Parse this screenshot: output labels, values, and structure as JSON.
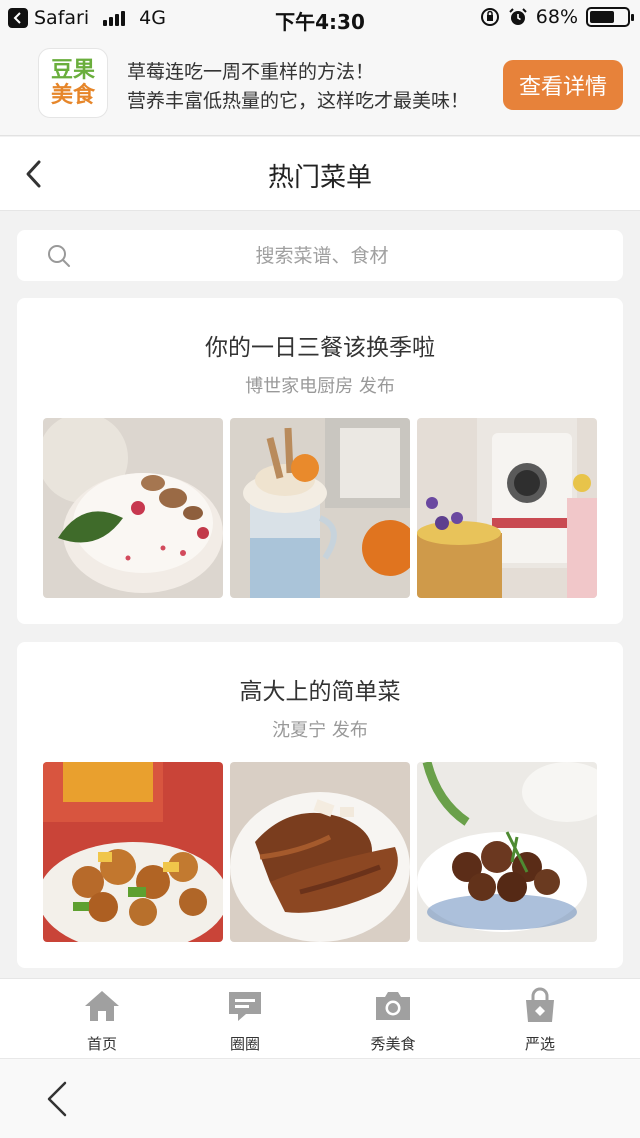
{
  "status_bar": {
    "app": "Safari",
    "network": "4G",
    "time": "下午4:30",
    "battery": "68%",
    "battery_level": 0.68
  },
  "banner": {
    "logo_line1": "豆果",
    "logo_line2": "美食",
    "line1": "草莓连吃一周不重样的方法！",
    "line2": "营养丰富低热量的它，这样吃才最美味！",
    "button": "查看详情"
  },
  "nav": {
    "title": "热门菜单",
    "back_icon": "chevron-left-icon"
  },
  "search": {
    "placeholder": "搜索菜谱、食材",
    "icon": "search-icon"
  },
  "menus": [
    {
      "title": "你的一日三餐该换季啦",
      "author": "博世家电厨房 发布"
    },
    {
      "title": "高大上的简单菜",
      "author": "沈夏宁 发布"
    }
  ],
  "tabs": [
    {
      "label": "首页",
      "icon": "home-icon"
    },
    {
      "label": "圈圈",
      "icon": "chat-icon"
    },
    {
      "label": "秀美食",
      "icon": "camera-icon"
    },
    {
      "label": "严选",
      "icon": "shopping-bag-icon"
    }
  ],
  "colors": {
    "accent": "#e7823a",
    "logo_green": "#6aae3c",
    "logo_orange": "#e6862a"
  }
}
